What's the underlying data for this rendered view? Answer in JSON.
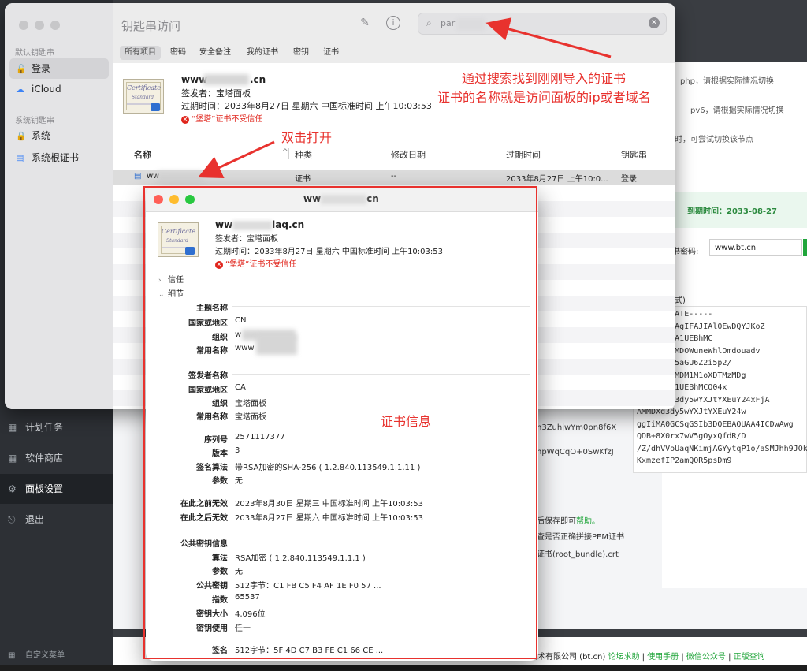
{
  "panel_sidebar": {
    "items": [
      {
        "icon": "calendar-icon",
        "label": "计划任务"
      },
      {
        "icon": "grid-icon",
        "label": "软件商店"
      },
      {
        "icon": "gear-icon",
        "label": "面板设置"
      },
      {
        "icon": "logout-icon",
        "label": "退出"
      }
    ],
    "custom_menu": "自定义菜单"
  },
  "panel_bg": {
    "tip1": "php，请根据实际情况切换",
    "tip2": "pv6，请根据实际情况切换",
    "tip3": "时，可尝试切换该节点",
    "expire": "到期时间：2033-08-27",
    "pw_label": "书密码:",
    "pw_value": "www.bt.cn",
    "format_label": "式)",
    "cert_lines": [
      "CERTIFICATE-----",
      "AwGgAwIBAgIFAJIAl0EwDQYJKoZ",
      "vzELMAkGA1UEBhMC",
      "TBgNVBAoMDOWuneWhlOmdouadv",
      "wwwM5a6d5aGU6Z2i5p2/",
      "MDgzMDAyMDM1M1oXDTMzMDg",
      "TELMAkGA1UEBhMCQ04x",
      "/BAoMDXd3dy5wYXJtYXEuY24xFjA",
      "AMMDXd3dy5wYXJtYXEuY24w",
      "ggIiMA0GCSqGSIb3DQEBAQUAA4ICDwAwg",
      "QDB+8X0rx7wV5gOyxQfdR/D",
      "/Z/dhVVoUaqNKimjAGYytqP1o/aSMJhh9JOkf",
      "KxmzefIP2amQOR5psDm9"
    ],
    "key_line1": "h3ZuhjwYm0pn8f6X",
    "key_line2": "npWqCqO+0SwKfzJ",
    "help_text": "后保存即可",
    "help_link": "帮助。",
    "pem_text": "查是否正确拼接PEM证书",
    "bundle_text": "证书(root_bundle).crt"
  },
  "footer": {
    "company": "技术有限公司 (bt.cn)",
    "links": [
      "论坛求助",
      "使用手册",
      "微信公众号",
      "正版查询"
    ]
  },
  "keychain": {
    "title": "钥匙串访问",
    "search_value": "par",
    "sections": [
      {
        "header": "默认钥匙串",
        "items": [
          {
            "icon": "lock-open-icon",
            "label": "登录"
          },
          {
            "icon": "cloud-icon",
            "label": "iCloud"
          }
        ]
      },
      {
        "header": "系统钥匙串",
        "items": [
          {
            "icon": "lock-icon",
            "label": "系统"
          },
          {
            "icon": "cabinet-icon",
            "label": "系统根证书"
          }
        ]
      }
    ],
    "tabs": [
      "所有项目",
      "密码",
      "安全备注",
      "我的证书",
      "密钥",
      "证书"
    ],
    "preview": {
      "name_prefix": "www",
      "name_suffix": ".cn",
      "issuer": "签发者：宝塔面板",
      "expires": "过期时间：2033年8月27日 星期六 中国标准时间 上午10:03:53",
      "warning": "“堡塔”证书不受信任"
    },
    "columns": [
      "名称",
      "种类",
      "修改日期",
      "过期时间",
      "钥匙串"
    ],
    "row": {
      "name": "ww",
      "kind": "证书",
      "modified": "--",
      "expires": "2033年8月27日 上午10:0...",
      "keychain": "登录"
    }
  },
  "cert_window": {
    "title_prefix": "ww",
    "title_suffix": "cn",
    "name_prefix": "ww",
    "name_suffix": "laq.cn",
    "issuer": "签发者：宝塔面板",
    "expires": "过期时间：2033年8月27日 星期六 中国标准时间 上午10:03:53",
    "warning": "“堡塔”证书不受信任",
    "trust": "信任",
    "details": "细节",
    "subject_section": "主题名称",
    "subject": [
      {
        "label": "国家或地区",
        "value": "CN"
      },
      {
        "label": "组织",
        "value": "w"
      },
      {
        "label": "常用名称",
        "value": "www"
      }
    ],
    "issuer_section": "签发者名称",
    "issuer_fields": [
      {
        "label": "国家或地区",
        "value": "CA"
      },
      {
        "label": "组织",
        "value": "宝塔面板"
      },
      {
        "label": "常用名称",
        "value": "宝塔面板"
      }
    ],
    "misc": [
      {
        "label": "序列号",
        "value": "2571117377"
      },
      {
        "label": "版本",
        "value": "3"
      },
      {
        "label": "签名算法",
        "value": "带RSA加密的SHA-256 ( 1.2.840.113549.1.1.11 )"
      },
      {
        "label": "参数",
        "value": "无"
      }
    ],
    "validity": [
      {
        "label": "在此之前无效",
        "value": "2023年8月30日 星期三 中国标准时间 上午10:03:53"
      },
      {
        "label": "在此之后无效",
        "value": "2033年8月27日 星期六 中国标准时间 上午10:03:53"
      }
    ],
    "pubkey_section": "公共密钥信息",
    "pubkey": [
      {
        "label": "算法",
        "value": "RSA加密 ( 1.2.840.113549.1.1.1 )"
      },
      {
        "label": "参数",
        "value": "无"
      },
      {
        "label": "公共密钥",
        "value": "512字节：C1 FB C5 F4 AF 1E F0 57 ..."
      },
      {
        "label": "指数",
        "value": "65537"
      },
      {
        "label": "密钥大小",
        "value": "4,096位"
      },
      {
        "label": "密钥使用",
        "value": "任一"
      }
    ],
    "signature": {
      "label": "签名",
      "value": "512字节：5F 4D C7 B3 FE C1 66 CE ..."
    }
  },
  "annotations": {
    "search_line1": "通过搜索找到刚刚导入的证书",
    "search_line2": "证书的名称就是访问面板的ip或者域名",
    "double_click": "双击打开",
    "cert_info": "证书信息"
  },
  "colors": {
    "accent_red": "#e8322e",
    "brand_green": "#20a53a"
  }
}
